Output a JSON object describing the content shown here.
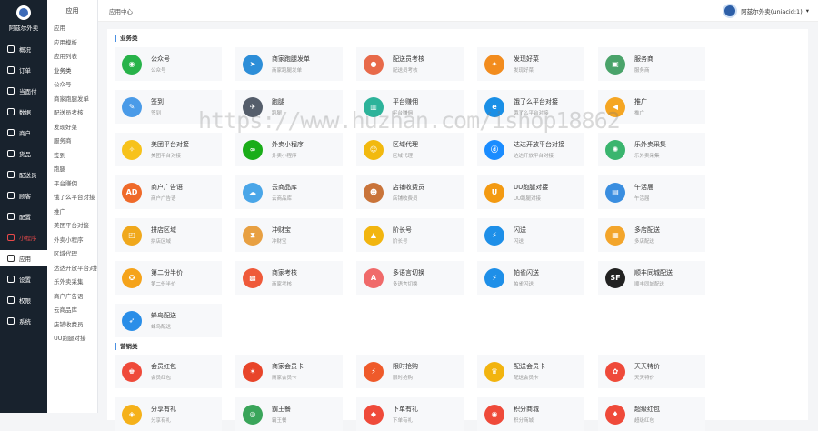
{
  "brand": {
    "title": "阿兹尔外卖"
  },
  "nav": [
    {
      "label": "概况",
      "icon": "overview-icon"
    },
    {
      "label": "订单",
      "icon": "order-icon"
    },
    {
      "label": "当面付",
      "icon": "pay-icon"
    },
    {
      "label": "数据",
      "icon": "data-icon"
    },
    {
      "label": "商户",
      "icon": "shop-icon"
    },
    {
      "label": "货品",
      "icon": "goods-icon"
    },
    {
      "label": "配送员",
      "icon": "rider-icon"
    },
    {
      "label": "顾客",
      "icon": "customer-icon"
    },
    {
      "label": "配置",
      "icon": "config-icon"
    },
    {
      "label": "小程序",
      "icon": "miniapp-icon"
    },
    {
      "label": "应用",
      "icon": "apps-icon"
    },
    {
      "label": "设置",
      "icon": "settings-icon"
    },
    {
      "label": "权限",
      "icon": "permission-icon"
    },
    {
      "label": "系统",
      "icon": "system-icon"
    }
  ],
  "sub": {
    "title": "应用",
    "items": [
      "应用",
      "应用模板",
      "应用列表",
      "业务类",
      "公众号",
      "商家跑腿发单",
      "配送员考核",
      "发现好菜",
      "服务商",
      "签到",
      "跑腿",
      "平台赚佣",
      "饿了么平台对接",
      "推广",
      "美团平台对接",
      "外卖小程序",
      "区域代理",
      "达达开放平台对接",
      "乐外卖采集",
      "商户广告语",
      "云商品库",
      "店铺收费员",
      "UU跑腿对接"
    ]
  },
  "header": {
    "breadcrumb": "应用中心",
    "user": "阿兹尔外卖(uniacid:1)"
  },
  "sections": [
    {
      "title": "业务类"
    },
    {
      "title": "营销类"
    }
  ],
  "business": [
    {
      "name": "公众号",
      "desc": "公众号",
      "icon": "wechat-icon",
      "color": "#28b34a",
      "glyph": "◉"
    },
    {
      "name": "商家跑腿发单",
      "desc": "商家跑腿发单",
      "icon": "paper-plane-icon",
      "color": "#2d8ed8",
      "glyph": "➤"
    },
    {
      "name": "配送员考核",
      "desc": "配送员考核",
      "icon": "globe-icon",
      "color": "#e86a4a",
      "glyph": "●"
    },
    {
      "name": "发现好菜",
      "desc": "发现好菜",
      "icon": "flame-icon",
      "color": "#f28c1e",
      "glyph": "✦"
    },
    {
      "name": "服务商",
      "desc": "服务商",
      "icon": "shop-icon",
      "color": "#4aa36a",
      "glyph": "▣"
    },
    {
      "name": "签到",
      "desc": "签到",
      "icon": "notepad-icon",
      "color": "#4a9be8",
      "glyph": "✎"
    },
    {
      "name": "跑腿",
      "desc": "跑腿",
      "icon": "runner-icon",
      "color": "#555e6b",
      "glyph": "✈"
    },
    {
      "name": "平台赚佣",
      "desc": "平台赚佣",
      "icon": "computer-icon",
      "color": "#2db39a",
      "glyph": "▥"
    },
    {
      "name": "饿了么平台对接",
      "desc": "饿了么平台对接",
      "icon": "eleme-icon",
      "color": "#1a8fe6",
      "glyph": "e"
    },
    {
      "name": "推广",
      "desc": "推广",
      "icon": "megaphone-icon",
      "color": "#f5a623",
      "glyph": "◀"
    },
    {
      "name": "美团平台对接",
      "desc": "美团平台对接",
      "icon": "bird-icon",
      "color": "#f7c21b",
      "glyph": "✧"
    },
    {
      "name": "外卖小程序",
      "desc": "外卖小程序",
      "icon": "miniprogram-icon",
      "color": "#1aad19",
      "glyph": "∞"
    },
    {
      "name": "区域代理",
      "desc": "区域代理",
      "icon": "agent-icon",
      "color": "#f2b90f",
      "glyph": "☺"
    },
    {
      "name": "达达开放平台对接",
      "desc": "达达开放平台对接",
      "icon": "dada-icon",
      "color": "#1a8cff",
      "glyph": "ⓓ"
    },
    {
      "name": "乐外卖采集",
      "desc": "乐外卖采集",
      "icon": "spider-icon",
      "color": "#3ab56e",
      "glyph": "✺"
    },
    {
      "name": "商户广告语",
      "desc": "商户广告语",
      "icon": "ad-icon",
      "color": "#ef6a2a",
      "glyph": "AD"
    },
    {
      "name": "云商品库",
      "desc": "云商品库",
      "icon": "cloud-icon",
      "color": "#4aa6e8",
      "glyph": "☁"
    },
    {
      "name": "店铺收费员",
      "desc": "店铺收费员",
      "icon": "cashier-icon",
      "color": "#c9743a",
      "glyph": "☻"
    },
    {
      "name": "UU跑腿对接",
      "desc": "UU跑腿对接",
      "icon": "uu-icon",
      "color": "#f39a12",
      "glyph": "U"
    },
    {
      "name": "午活届",
      "desc": "午活届",
      "icon": "building-icon",
      "color": "#3a8ee0",
      "glyph": "▤"
    },
    {
      "name": "拼店区域",
      "desc": "拼店区域",
      "icon": "map-icon",
      "color": "#f0a81c",
      "glyph": "◰"
    },
    {
      "name": "冲财宝",
      "desc": "冲财宝",
      "icon": "hourglass-icon",
      "color": "#e8a042",
      "glyph": "⧗"
    },
    {
      "name": "阶长号",
      "desc": "阶长号",
      "icon": "lock-icon",
      "color": "#f2b50f",
      "glyph": "▲"
    },
    {
      "name": "闪送",
      "desc": "闪送",
      "icon": "flash-icon",
      "color": "#1e8fe8",
      "glyph": "⚡"
    },
    {
      "name": "多店配送",
      "desc": "多店配送",
      "icon": "delivery-icon",
      "color": "#f3a52b",
      "glyph": "▦"
    },
    {
      "name": "第二份半价",
      "desc": "第二份半价",
      "icon": "coupon-icon",
      "color": "#f5a31a",
      "glyph": "✪"
    },
    {
      "name": "商家考核",
      "desc": "商家考核",
      "icon": "evaluate-icon",
      "color": "#ef5a3a",
      "glyph": "▩"
    },
    {
      "name": "多语言切换",
      "desc": "多语言切换",
      "icon": "language-icon",
      "color": "#f06a6a",
      "glyph": "A"
    },
    {
      "name": "帕雀闪送",
      "desc": "帕雀闪送",
      "icon": "bolt-icon",
      "color": "#1e8fe8",
      "glyph": "⚡"
    },
    {
      "name": "顺丰同城配送",
      "desc": "顺丰同城配送",
      "icon": "sf-icon",
      "color": "#222",
      "glyph": "SF"
    },
    {
      "name": "蜂鸟配送",
      "desc": "蜂鸟配送",
      "icon": "hummingbird-icon",
      "color": "#2a8ee8",
      "glyph": "➶"
    }
  ],
  "marketing": [
    {
      "name": "会员红包",
      "desc": "会员红包",
      "icon": "redpacket-icon",
      "color": "#ef4a3a",
      "glyph": "♚"
    },
    {
      "name": "商家会员卡",
      "desc": "商家会员卡",
      "icon": "star-card-icon",
      "color": "#e8452a",
      "glyph": "✶"
    },
    {
      "name": "限时抢购",
      "desc": "限时抢购",
      "icon": "flash-sale-icon",
      "color": "#ef5a2a",
      "glyph": "⚡"
    },
    {
      "name": "配送会员卡",
      "desc": "配送会员卡",
      "icon": "crown-icon",
      "color": "#f2b40f",
      "glyph": "♛"
    },
    {
      "name": "天天特价",
      "desc": "天天特价",
      "icon": "tag-icon",
      "color": "#ef4a3a",
      "glyph": "✿"
    },
    {
      "name": "分享有礼",
      "desc": "分享有礼",
      "icon": "gift-icon",
      "color": "#f5b11a",
      "glyph": "◈"
    },
    {
      "name": "霸王餐",
      "desc": "霸王餐",
      "icon": "meal-icon",
      "color": "#3aa55a",
      "glyph": "◎"
    },
    {
      "name": "下单有礼",
      "desc": "下单有礼",
      "icon": "order-gift-icon",
      "color": "#ef4a3a",
      "glyph": "◆"
    },
    {
      "name": "积分商城",
      "desc": "积分商城",
      "icon": "points-icon",
      "color": "#ef4a3a",
      "glyph": "◉"
    },
    {
      "name": "超级红包",
      "desc": "超级红包",
      "icon": "super-redpacket-icon",
      "color": "#ef4a3a",
      "glyph": "♦"
    }
  ],
  "watermark": "https://www.huzhan.com/ishop18862"
}
